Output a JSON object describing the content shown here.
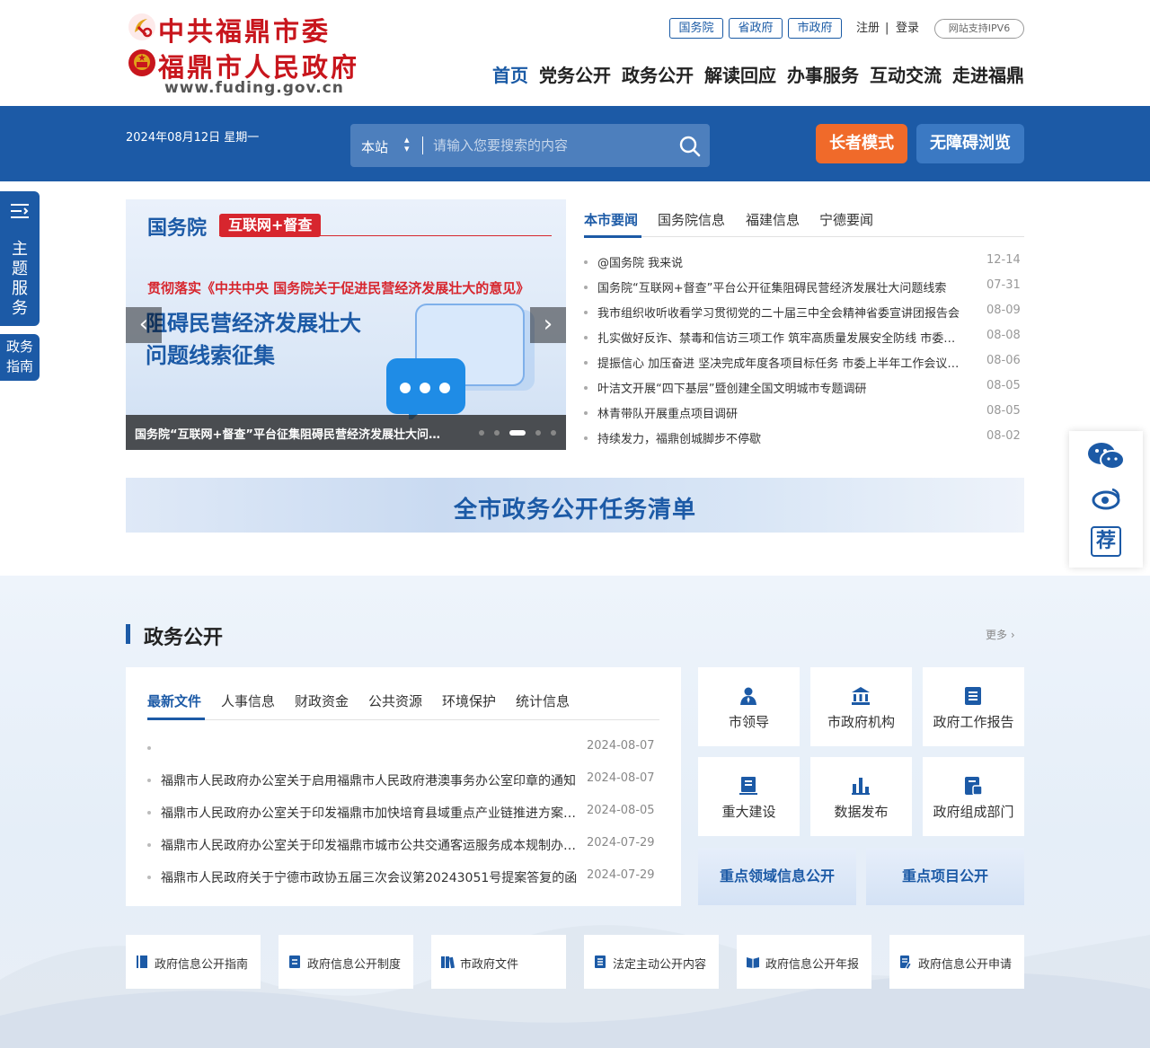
{
  "header": {
    "logo": {
      "line1": "中共福鼎市委",
      "line2": "福鼎市人民政府",
      "url": "www.fuding.gov.cn"
    },
    "toplinks": [
      "国务院",
      "省政府",
      "市政府"
    ],
    "register": "注册",
    "login": "登录",
    "separator": "|",
    "ipv6": "网站支持IPV6",
    "nav": [
      "首页",
      "党务公开",
      "政务公开",
      "解读回应",
      "办事服务",
      "互动交流",
      "走进福鼎"
    ]
  },
  "band": {
    "date": "2024年08月12日 星期一",
    "search_scope": "本站",
    "search_placeholder": "请输入您要搜索的内容",
    "elder_mode": "长者模式",
    "accessible": "无障碍浏览"
  },
  "left_float": {
    "topic_service": "主题服务",
    "gov_guide_1": "政务",
    "gov_guide_2": "指南"
  },
  "right_float": {
    "recommend": "荐"
  },
  "slider": {
    "brand": "国务院",
    "tag": "互联网+督查",
    "subtitle": "贯彻落实《中共中央 国务院关于促进民营经济发展壮大的意见》",
    "big1": "阻碍民营经济发展壮大",
    "big2": "问题线索征集",
    "caption": "国务院“互联网+督查”平台征集阻碍民营经济发展壮大问题线索",
    "dots": 5,
    "active_dot": 3
  },
  "news": {
    "tabs": [
      "本市要闻",
      "国务院信息",
      "福建信息",
      "宁德要闻"
    ],
    "items": [
      {
        "title": "@国务院 我来说",
        "date": "12-14"
      },
      {
        "title": "国务院“互联网+督查”平台公开征集阻碍民营经济发展壮大问题线索",
        "date": "07-31"
      },
      {
        "title": "我市组织收听收看学习贯彻党的二十届三中全会精神省委宣讲团报告会",
        "date": "08-09"
      },
      {
        "title": "扎实做好反诈、禁毒和信访三项工作 筑牢高质量发展安全防线 市委召开会议",
        "date": "08-08"
      },
      {
        "title": "提振信心 加压奋进 坚决完成年度各项目标任务 市委上半年工作会议召开",
        "date": "08-06"
      },
      {
        "title": "叶洁文开展“四下基层”暨创建全国文明城市专题调研",
        "date": "08-05"
      },
      {
        "title": "林青带队开展重点项目调研",
        "date": "08-05"
      },
      {
        "title": "持续发力，福鼎创城脚步不停歇",
        "date": "08-02"
      }
    ]
  },
  "banner": "全市政务公开任务清单",
  "section": {
    "title": "政务公开",
    "more": "更多",
    "doc_tabs": [
      "最新文件",
      "人事信息",
      "财政资金",
      "公共资源",
      "环境保护",
      "统计信息"
    ],
    "docs": [
      {
        "title": "",
        "date": "2024-08-07"
      },
      {
        "title": "福鼎市人民政府办公室关于启用福鼎市人民政府港澳事务办公室印章的通知",
        "date": "2024-08-07"
      },
      {
        "title": "福鼎市人民政府办公室关于印发福鼎市加快培育县域重点产业链推进方案的通知",
        "date": "2024-08-05"
      },
      {
        "title": "福鼎市人民政府办公室关于印发福鼎市城市公共交通客运服务成本规制办法的通知",
        "date": "2024-07-29"
      },
      {
        "title": "福鼎市人民政府关于宁德市政协五届三次会议第20243051号提案答复的函",
        "date": "2024-07-29"
      }
    ],
    "tiles": [
      "市领导",
      "市政府机构",
      "政府工作报告",
      "重大建设",
      "数据发布",
      "政府组成部门"
    ],
    "feature_tiles": [
      "重点领域信息公开",
      "重点项目公开"
    ],
    "bottom_tiles": [
      "政府信息公开指南",
      "政府信息公开制度",
      "市政府文件",
      "法定主动公开内容",
      "政府信息公开年报",
      "政府信息公开申请"
    ]
  },
  "colors": {
    "brand_blue": "#1c5aa6",
    "logo_red": "#c8161d",
    "elder_orange": "#f06a2a",
    "accessible_blue": "#3b79c3"
  }
}
